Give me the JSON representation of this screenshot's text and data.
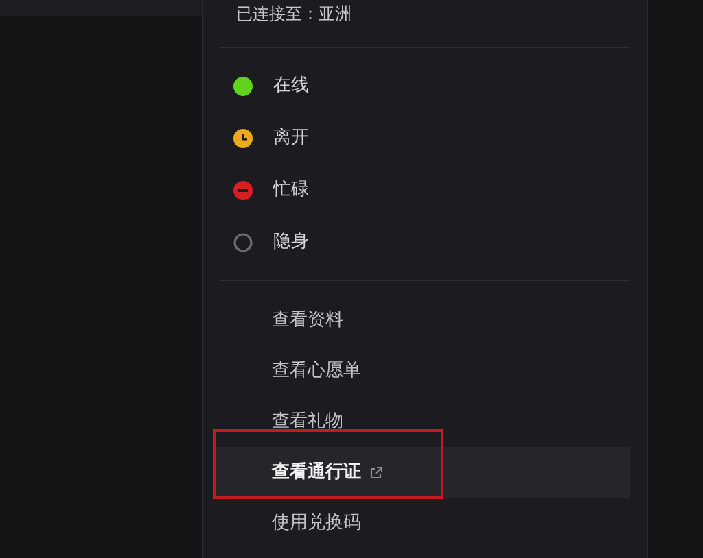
{
  "connection": {
    "text": "已连接至：亚洲"
  },
  "statuses": [
    {
      "label": "在线",
      "kind": "online",
      "color": "#5fd41e"
    },
    {
      "label": "离开",
      "kind": "away",
      "color": "#f0a81c"
    },
    {
      "label": "忙碌",
      "kind": "busy",
      "color": "#d41f23"
    },
    {
      "label": "隐身",
      "kind": "invisible",
      "color": "#6b6b70"
    }
  ],
  "links": [
    {
      "label": "查看资料",
      "hovered": false,
      "external": false,
      "highlighted": false
    },
    {
      "label": "查看心愿单",
      "hovered": false,
      "external": false,
      "highlighted": false
    },
    {
      "label": "查看礼物",
      "hovered": false,
      "external": false,
      "highlighted": false
    },
    {
      "label": "查看通行证",
      "hovered": true,
      "external": true,
      "highlighted": true
    },
    {
      "label": "使用兑换码",
      "hovered": false,
      "external": false,
      "highlighted": false
    }
  ]
}
